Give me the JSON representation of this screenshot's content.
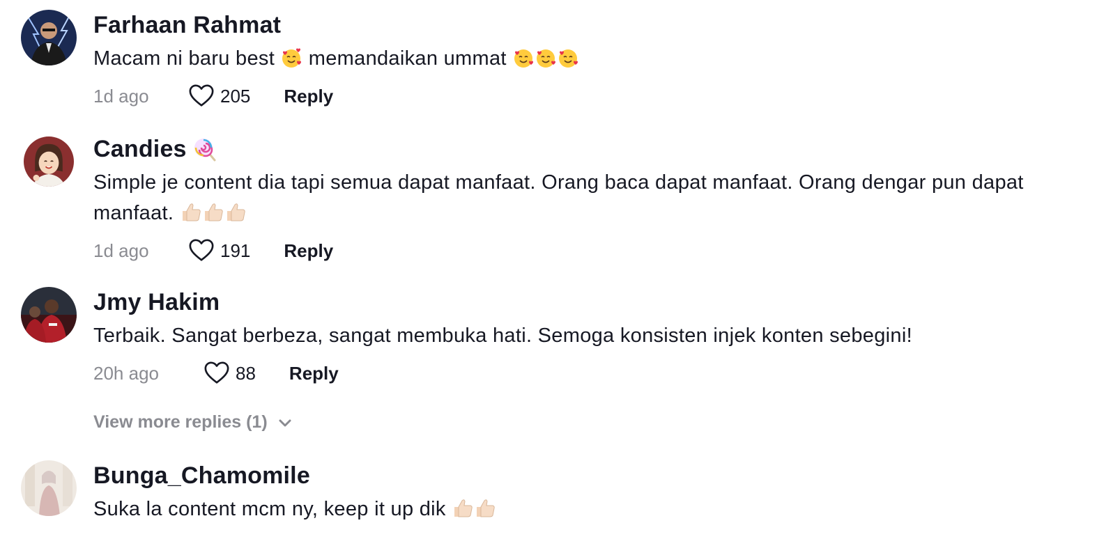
{
  "comments": [
    {
      "username": "Farhaan Rahmat",
      "text": "Macam ni baru best",
      "text_mid": " memandaikan ummat ",
      "time": "1d ago",
      "likes": "205",
      "reply_label": "Reply"
    },
    {
      "username": "Candies",
      "text": "Simple je content dia tapi semua dapat manfaat. Orang baca dapat manfaat. Orang dengar pun dapat manfaat.",
      "time": "1d ago",
      "likes": "191",
      "reply_label": "Reply"
    },
    {
      "username": "Jmy Hakim",
      "text": "Terbaik. Sangat berbeza, sangat membuka hati. Semoga konsisten injek konten sebegini!",
      "time": "20h ago",
      "likes": "88",
      "reply_label": "Reply"
    },
    {
      "username": "Bunga_Chamomile",
      "text": "Suka la content mcm ny, keep it up dik"
    }
  ],
  "view_more_replies": "View more replies (1)",
  "icons": {
    "like": "heart-outline-icon",
    "expand": "chevron-down-icon",
    "smiling_hearts": "smiling-face-with-hearts-emoji",
    "thumbs_up": "thumbs-up-emoji",
    "lollipop": "lollipop-emoji"
  },
  "colors": {
    "text": "#161823",
    "muted": "#8a8b91",
    "background": "#ffffff"
  }
}
